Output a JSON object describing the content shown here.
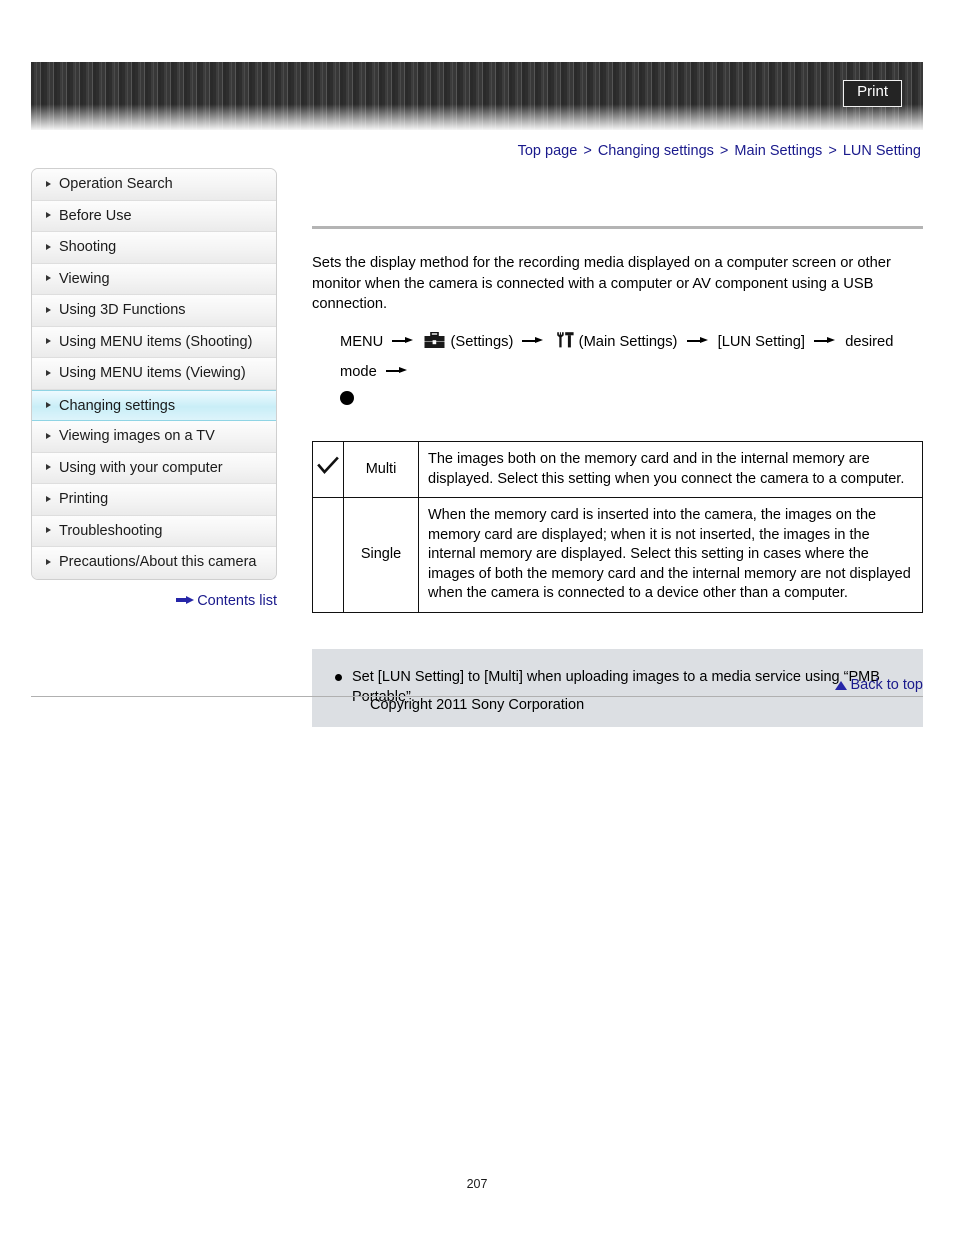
{
  "header": {
    "print_label": "Print"
  },
  "breadcrumb": {
    "separator": ">",
    "items": [
      {
        "label": "Top page"
      },
      {
        "label": "Changing settings"
      },
      {
        "label": "Main Settings"
      },
      {
        "label": "LUN Setting"
      }
    ]
  },
  "sidebar": {
    "items": [
      {
        "label": "Operation Search",
        "active": false
      },
      {
        "label": "Before Use",
        "active": false
      },
      {
        "label": "Shooting",
        "active": false
      },
      {
        "label": "Viewing",
        "active": false
      },
      {
        "label": "Using 3D Functions",
        "active": false
      },
      {
        "label": "Using MENU items (Shooting)",
        "active": false
      },
      {
        "label": "Using MENU items (Viewing)",
        "active": false
      },
      {
        "label": "Changing settings",
        "active": true
      },
      {
        "label": "Viewing images on a TV",
        "active": false
      },
      {
        "label": "Using with your computer",
        "active": false
      },
      {
        "label": "Printing",
        "active": false
      },
      {
        "label": "Troubleshooting",
        "active": false
      },
      {
        "label": "Precautions/About this camera",
        "active": false
      }
    ],
    "contents_list_label": "Contents list"
  },
  "main": {
    "intro": "Sets the display method for the recording media displayed on a computer screen or other monitor when the camera is connected with a computer or AV component using a USB connection.",
    "menu_path": {
      "start": "MENU",
      "settings_label": "(Settings)",
      "main_settings_label": "(Main Settings)",
      "lun_setting_label": "[LUN Setting]",
      "desired_mode_label": "desired mode"
    },
    "table": {
      "rows": [
        {
          "checked": true,
          "name": "Multi",
          "description": "The images both on the memory card and in the internal memory are displayed. Select this setting when you connect the camera to a computer."
        },
        {
          "checked": false,
          "name": "Single",
          "description": "When the memory card is inserted into the camera, the images on the memory card are displayed; when it is not inserted, the images in the internal memory are displayed. Select this setting in cases where the images of both the memory card and the internal memory are not displayed when the camera is connected to a device other than a computer."
        }
      ]
    },
    "note": "Set [LUN Setting] to [Multi] when uploading images to a media service using “PMB Portable”."
  },
  "footer": {
    "back_to_top_label": "Back to top",
    "copyright": "Copyright 2011 Sony Corporation",
    "page_number": "207"
  },
  "colors": {
    "link": "#1a1a8c",
    "active_nav": "#c9eef7",
    "note_bg": "#dcdfe3",
    "rule": "#b4b4b4"
  }
}
